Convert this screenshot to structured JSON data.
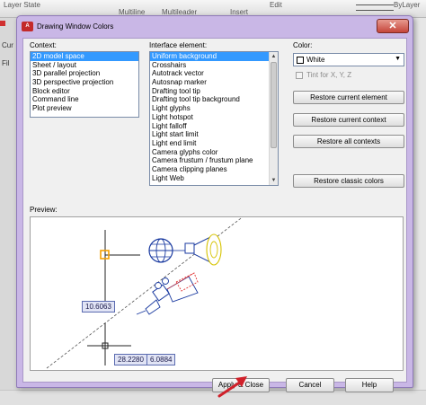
{
  "background": {
    "ribbon": {
      "layer_state": "Layer State",
      "multiline": "Multiline",
      "multileader": "Multileader",
      "insert": "Insert",
      "edit": "Edit",
      "bylayer": "ByLayer"
    },
    "side_labels": [
      "Cur",
      "Fil"
    ]
  },
  "dialog": {
    "icon_text": "A",
    "title": "Drawing Window Colors",
    "close_glyph": "✕",
    "context": {
      "label": "Context:",
      "items": [
        "2D model space",
        "Sheet / layout",
        "3D parallel projection",
        "3D perspective projection",
        "Block editor",
        "Command line",
        "Plot preview"
      ],
      "selected_index": 0
    },
    "interface_element": {
      "label": "Interface element:",
      "items": [
        "Uniform background",
        "Crosshairs",
        "Autotrack vector",
        "Autosnap marker",
        "Drafting tool tip",
        "Drafting tool tip background",
        "Light glyphs",
        "Light hotspot",
        "Light falloff",
        "Light start limit",
        "Light end limit",
        "Camera glyphs color",
        "Camera frustum / frustum plane",
        "Camera clipping planes",
        "Light Web"
      ],
      "selected_index": 0
    },
    "color": {
      "label": "Color:",
      "value": "White",
      "tint_label": "Tint for X, Y, Z",
      "tint_checked": false
    },
    "buttons": {
      "restore_current_element": "Restore current element",
      "restore_current_context": "Restore current context",
      "restore_all_contexts": "Restore all contexts",
      "restore_classic_colors": "Restore classic colors",
      "apply_close": "Apply & Close",
      "cancel": "Cancel",
      "help": "Help"
    },
    "preview": {
      "label": "Preview:",
      "tooltip_1": "10.6063",
      "tooltip_2": "28.2280",
      "tooltip_3": "6.0884"
    }
  },
  "colors": {
    "dialog_frame": "#c9b7e6",
    "selection": "#3399ff",
    "annotation_arrow": "#d0202a"
  }
}
